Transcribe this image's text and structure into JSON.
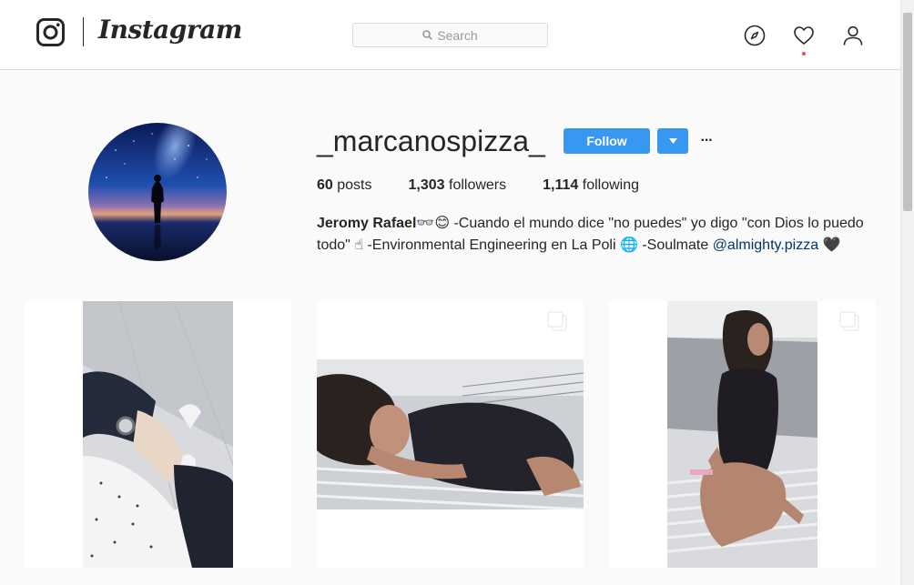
{
  "header": {
    "wordmark": "Instagram",
    "search_placeholder": "Search",
    "icons": [
      "instagram-glyph-icon",
      "compass-icon",
      "heart-icon",
      "person-icon"
    ],
    "activity_dot_color": "#ed4956"
  },
  "profile": {
    "username": "_marcanospizza_",
    "follow_label": "Follow",
    "more_label": "···",
    "accent": "#3897f0",
    "stats": {
      "posts_count": "60",
      "posts_label": "posts",
      "followers_count": "1,303",
      "followers_label": "followers",
      "following_count": "1,114",
      "following_label": "following"
    },
    "bio": {
      "name": "Jeromy Rafael",
      "text_1": "👓😊 -Cuando el mundo dice \"no puedes\" yo digo \"con Dios lo puedo todo\" ☝ -Environmental Engineering en La Poli 🌐 -Soulmate ",
      "mention": "@almighty.pizza",
      "text_2": " 🖤"
    }
  },
  "posts": [
    {
      "type": "single",
      "subject": "wrist-watch-photo"
    },
    {
      "type": "multiple",
      "subject": "lounging-on-chair-photo"
    },
    {
      "type": "multiple",
      "subject": "sitting-by-pool-photo"
    }
  ]
}
